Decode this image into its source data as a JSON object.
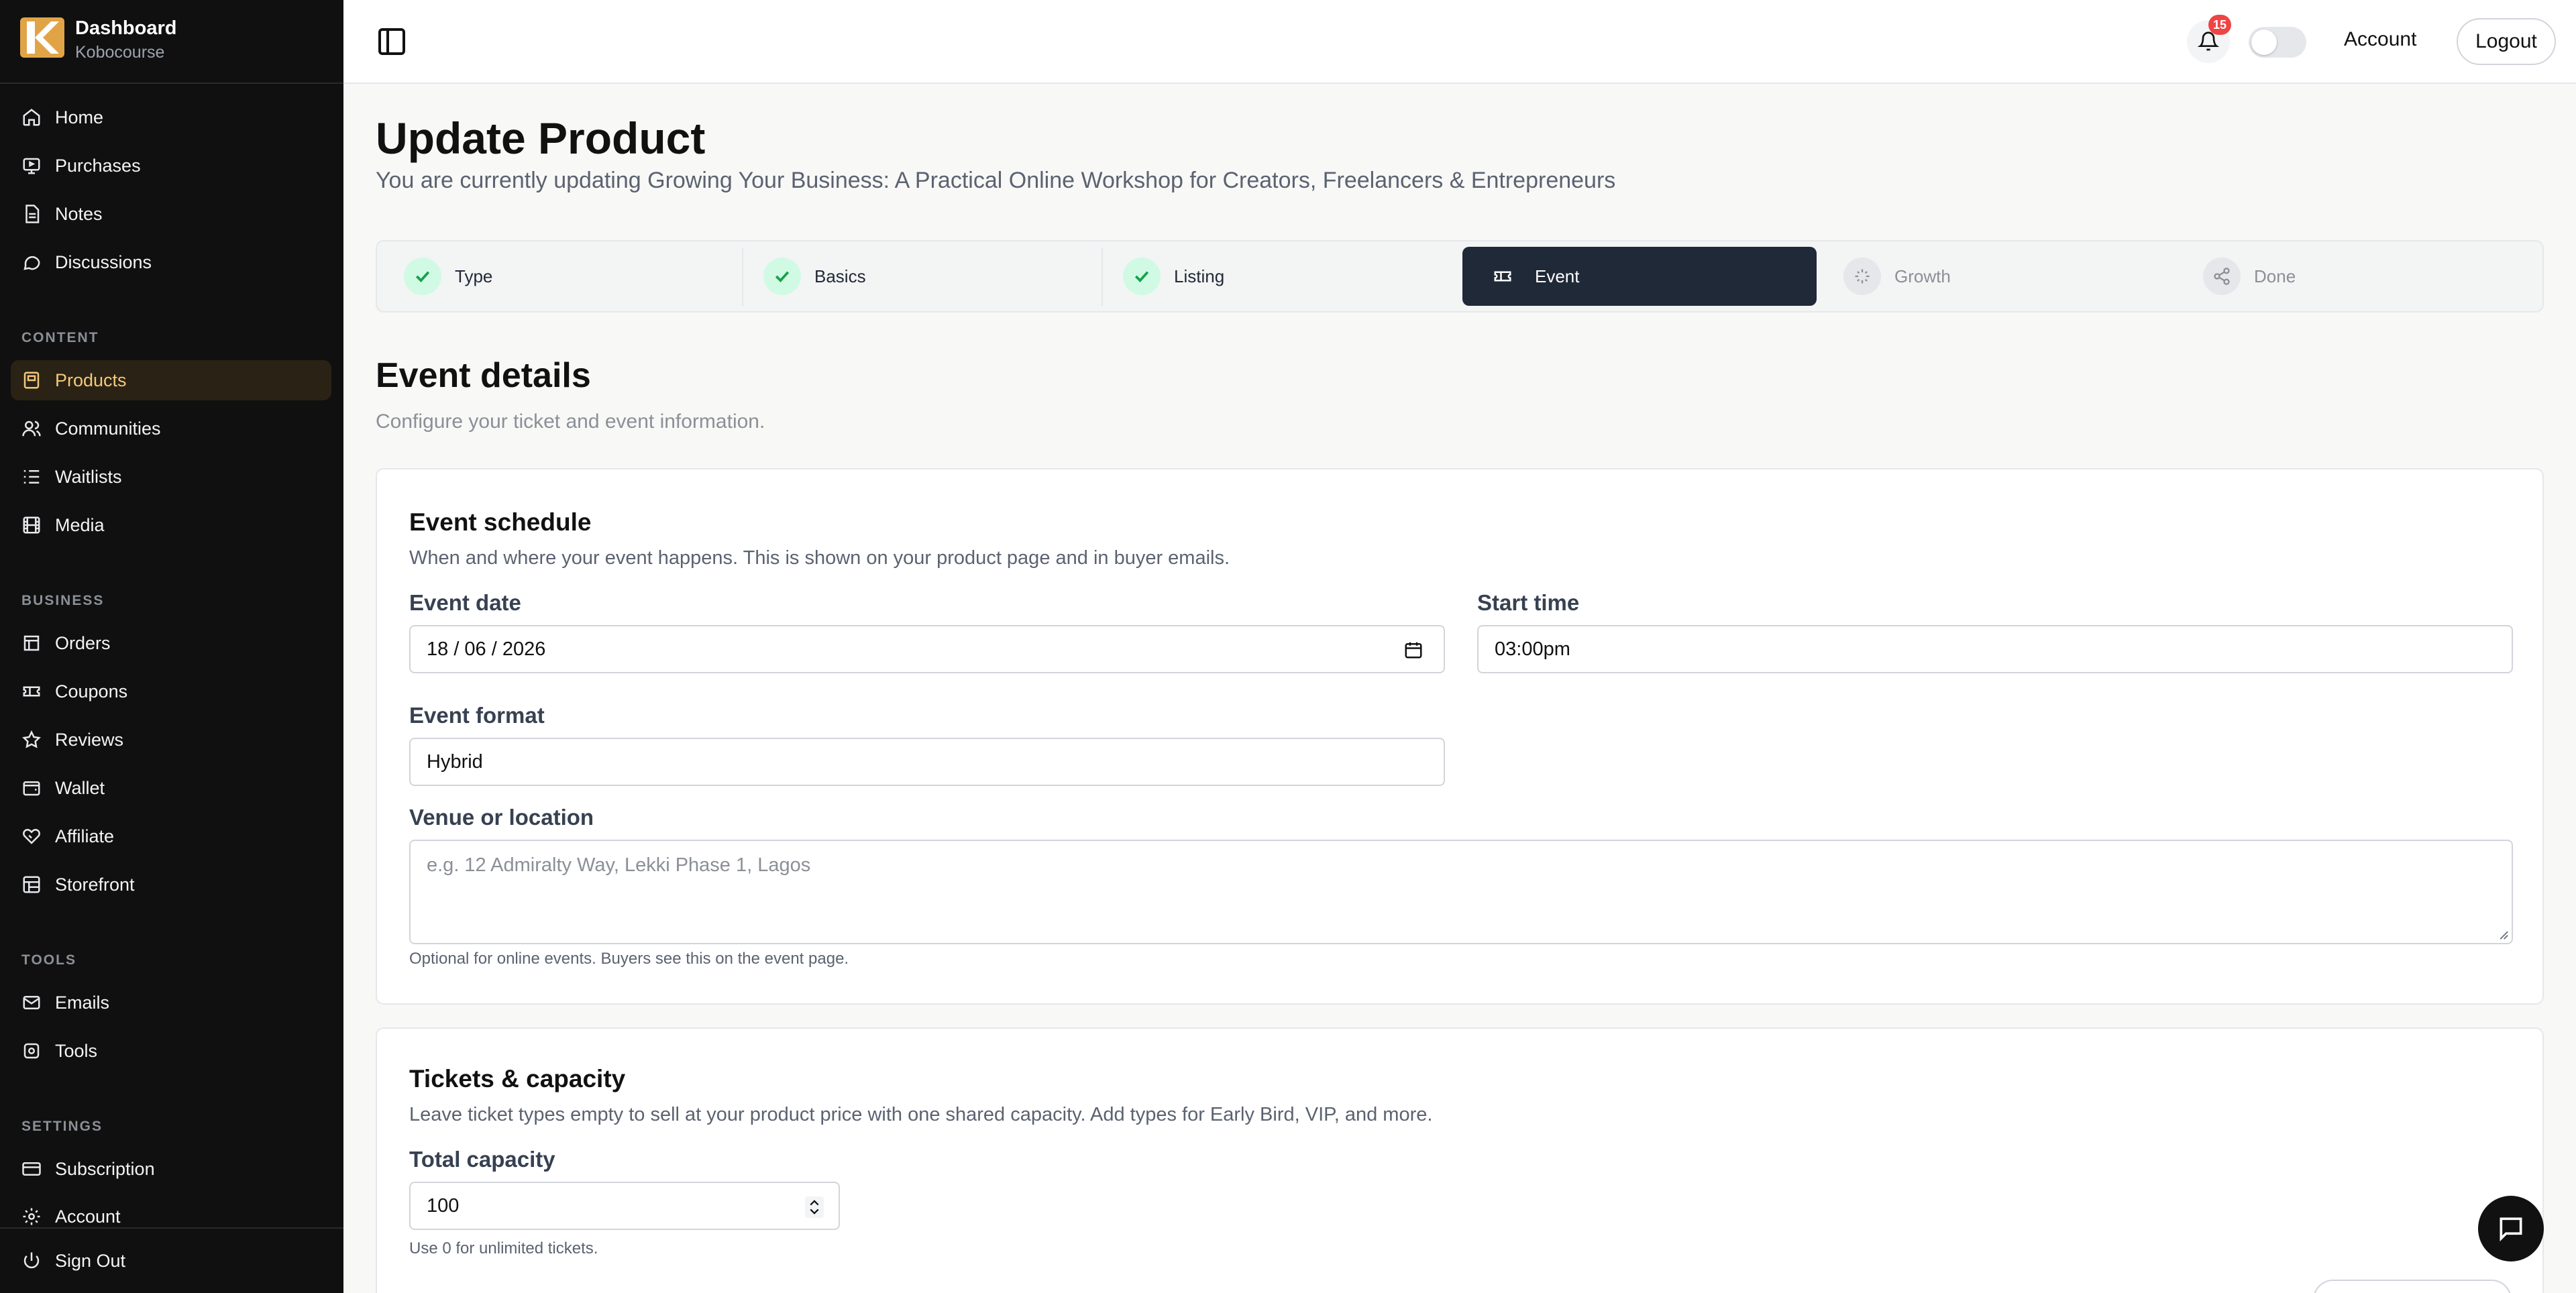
{
  "brand": {
    "title": "Dashboard",
    "subtitle": "Kobocourse"
  },
  "sidebar": {
    "main": [
      {
        "label": "Home",
        "icon": "home-icon"
      },
      {
        "label": "Purchases",
        "icon": "purchases-icon"
      },
      {
        "label": "Notes",
        "icon": "notes-icon"
      },
      {
        "label": "Discussions",
        "icon": "chat-icon"
      }
    ],
    "content_heading": "CONTENT",
    "content": [
      {
        "label": "Products",
        "icon": "products-icon",
        "active": true
      },
      {
        "label": "Communities",
        "icon": "users-icon"
      },
      {
        "label": "Waitlists",
        "icon": "list-icon"
      },
      {
        "label": "Media",
        "icon": "film-icon"
      }
    ],
    "business_heading": "BUSINESS",
    "business": [
      {
        "label": "Orders",
        "icon": "orders-icon"
      },
      {
        "label": "Coupons",
        "icon": "ticket-icon"
      },
      {
        "label": "Reviews",
        "icon": "star-icon"
      },
      {
        "label": "Wallet",
        "icon": "wallet-icon"
      },
      {
        "label": "Affiliate",
        "icon": "handshake-icon"
      },
      {
        "label": "Storefront",
        "icon": "storefront-icon"
      }
    ],
    "tools_heading": "TOOLS",
    "tools": [
      {
        "label": "Emails",
        "icon": "mail-icon"
      },
      {
        "label": "Tools",
        "icon": "tools-icon"
      }
    ],
    "settings_heading": "SETTINGS",
    "settings": [
      {
        "label": "Subscription",
        "icon": "card-icon"
      },
      {
        "label": "Account",
        "icon": "gear-icon"
      }
    ],
    "signout": "Sign Out"
  },
  "topbar": {
    "notifications_count": "15",
    "account": "Account",
    "logout": "Logout",
    "theme_toggle_on": false
  },
  "page": {
    "title": "Update Product",
    "subtitle": "You are currently updating Growing Your Business: A Practical Online Workshop for Creators, Freelancers & Entrepreneurs"
  },
  "steps": [
    {
      "label": "Type",
      "state": "done"
    },
    {
      "label": "Basics",
      "state": "done"
    },
    {
      "label": "Listing",
      "state": "done"
    },
    {
      "label": "Event",
      "state": "active"
    },
    {
      "label": "Growth",
      "state": "inactive"
    },
    {
      "label": "Done",
      "state": "inactive"
    }
  ],
  "section": {
    "title": "Event details",
    "subtitle": "Configure your ticket and event information."
  },
  "schedule": {
    "title": "Event schedule",
    "desc": "When and where your event happens. This is shown on your product page and in buyer emails.",
    "date_label": "Event date",
    "date_value": "18 / 06 / 2026",
    "time_label": "Start time",
    "time_value": "03:00pm",
    "format_label": "Event format",
    "format_value": "Hybrid",
    "venue_label": "Venue or location",
    "venue_placeholder": "e.g. 12 Admiralty Way, Lekki Phase 1, Lagos",
    "venue_hint": "Optional for online events. Buyers see this on the event page."
  },
  "tickets": {
    "title": "Tickets & capacity",
    "desc": "Leave ticket types empty to sell at your product price with one shared capacity. Add types for Early Bird, VIP, and more.",
    "capacity_label": "Total capacity",
    "capacity_value": "100",
    "capacity_hint": "Use 0 for unlimited tickets."
  },
  "colors": {
    "accent": "#f3c97a",
    "sidebar_bg": "#101010",
    "active_step_bg": "#1f2937",
    "success": "#16a34a",
    "badge": "#ef4444"
  }
}
